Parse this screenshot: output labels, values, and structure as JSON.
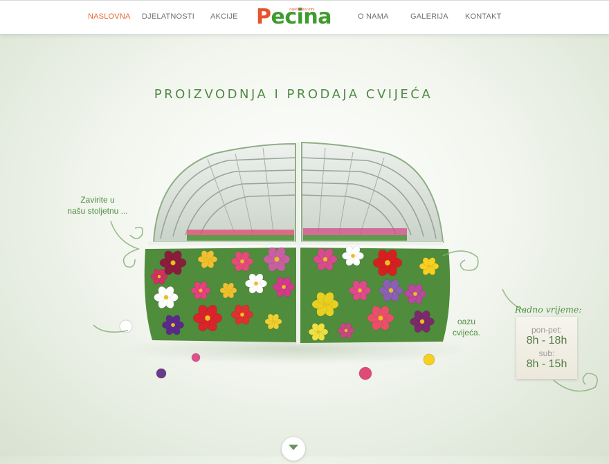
{
  "nav": {
    "items": [
      {
        "label": "NASLOVNA",
        "active": true
      },
      {
        "label": "DJELATNOSTI"
      },
      {
        "label": "AKCIJE"
      },
      {
        "label": "O NAMA"
      },
      {
        "label": "GALERIJA"
      },
      {
        "label": "KONTAKT"
      }
    ],
    "logo": {
      "text_first": "P",
      "text_rest": "ecina",
      "tagline": "cvjećarnica vrtni"
    }
  },
  "hero": {
    "title": "PROIZVODNJA I PRODAJA CVIJEĆA",
    "left_text_1": "Zavirite u",
    "left_text_2": "našu stoljetnu ...",
    "right_text_1": "oazu",
    "right_text_2": "cvijeća."
  },
  "hours": {
    "label": "Radno vrijeme:",
    "weekday_label": "pon-pet:",
    "weekday_value": "8h - 18h",
    "saturday_label": "sub:",
    "saturday_value": "8h - 15h"
  },
  "colors": {
    "accent": "#e8672c",
    "green": "#4f8a44"
  },
  "icons": {
    "scroll": "chevron-down-icon"
  }
}
